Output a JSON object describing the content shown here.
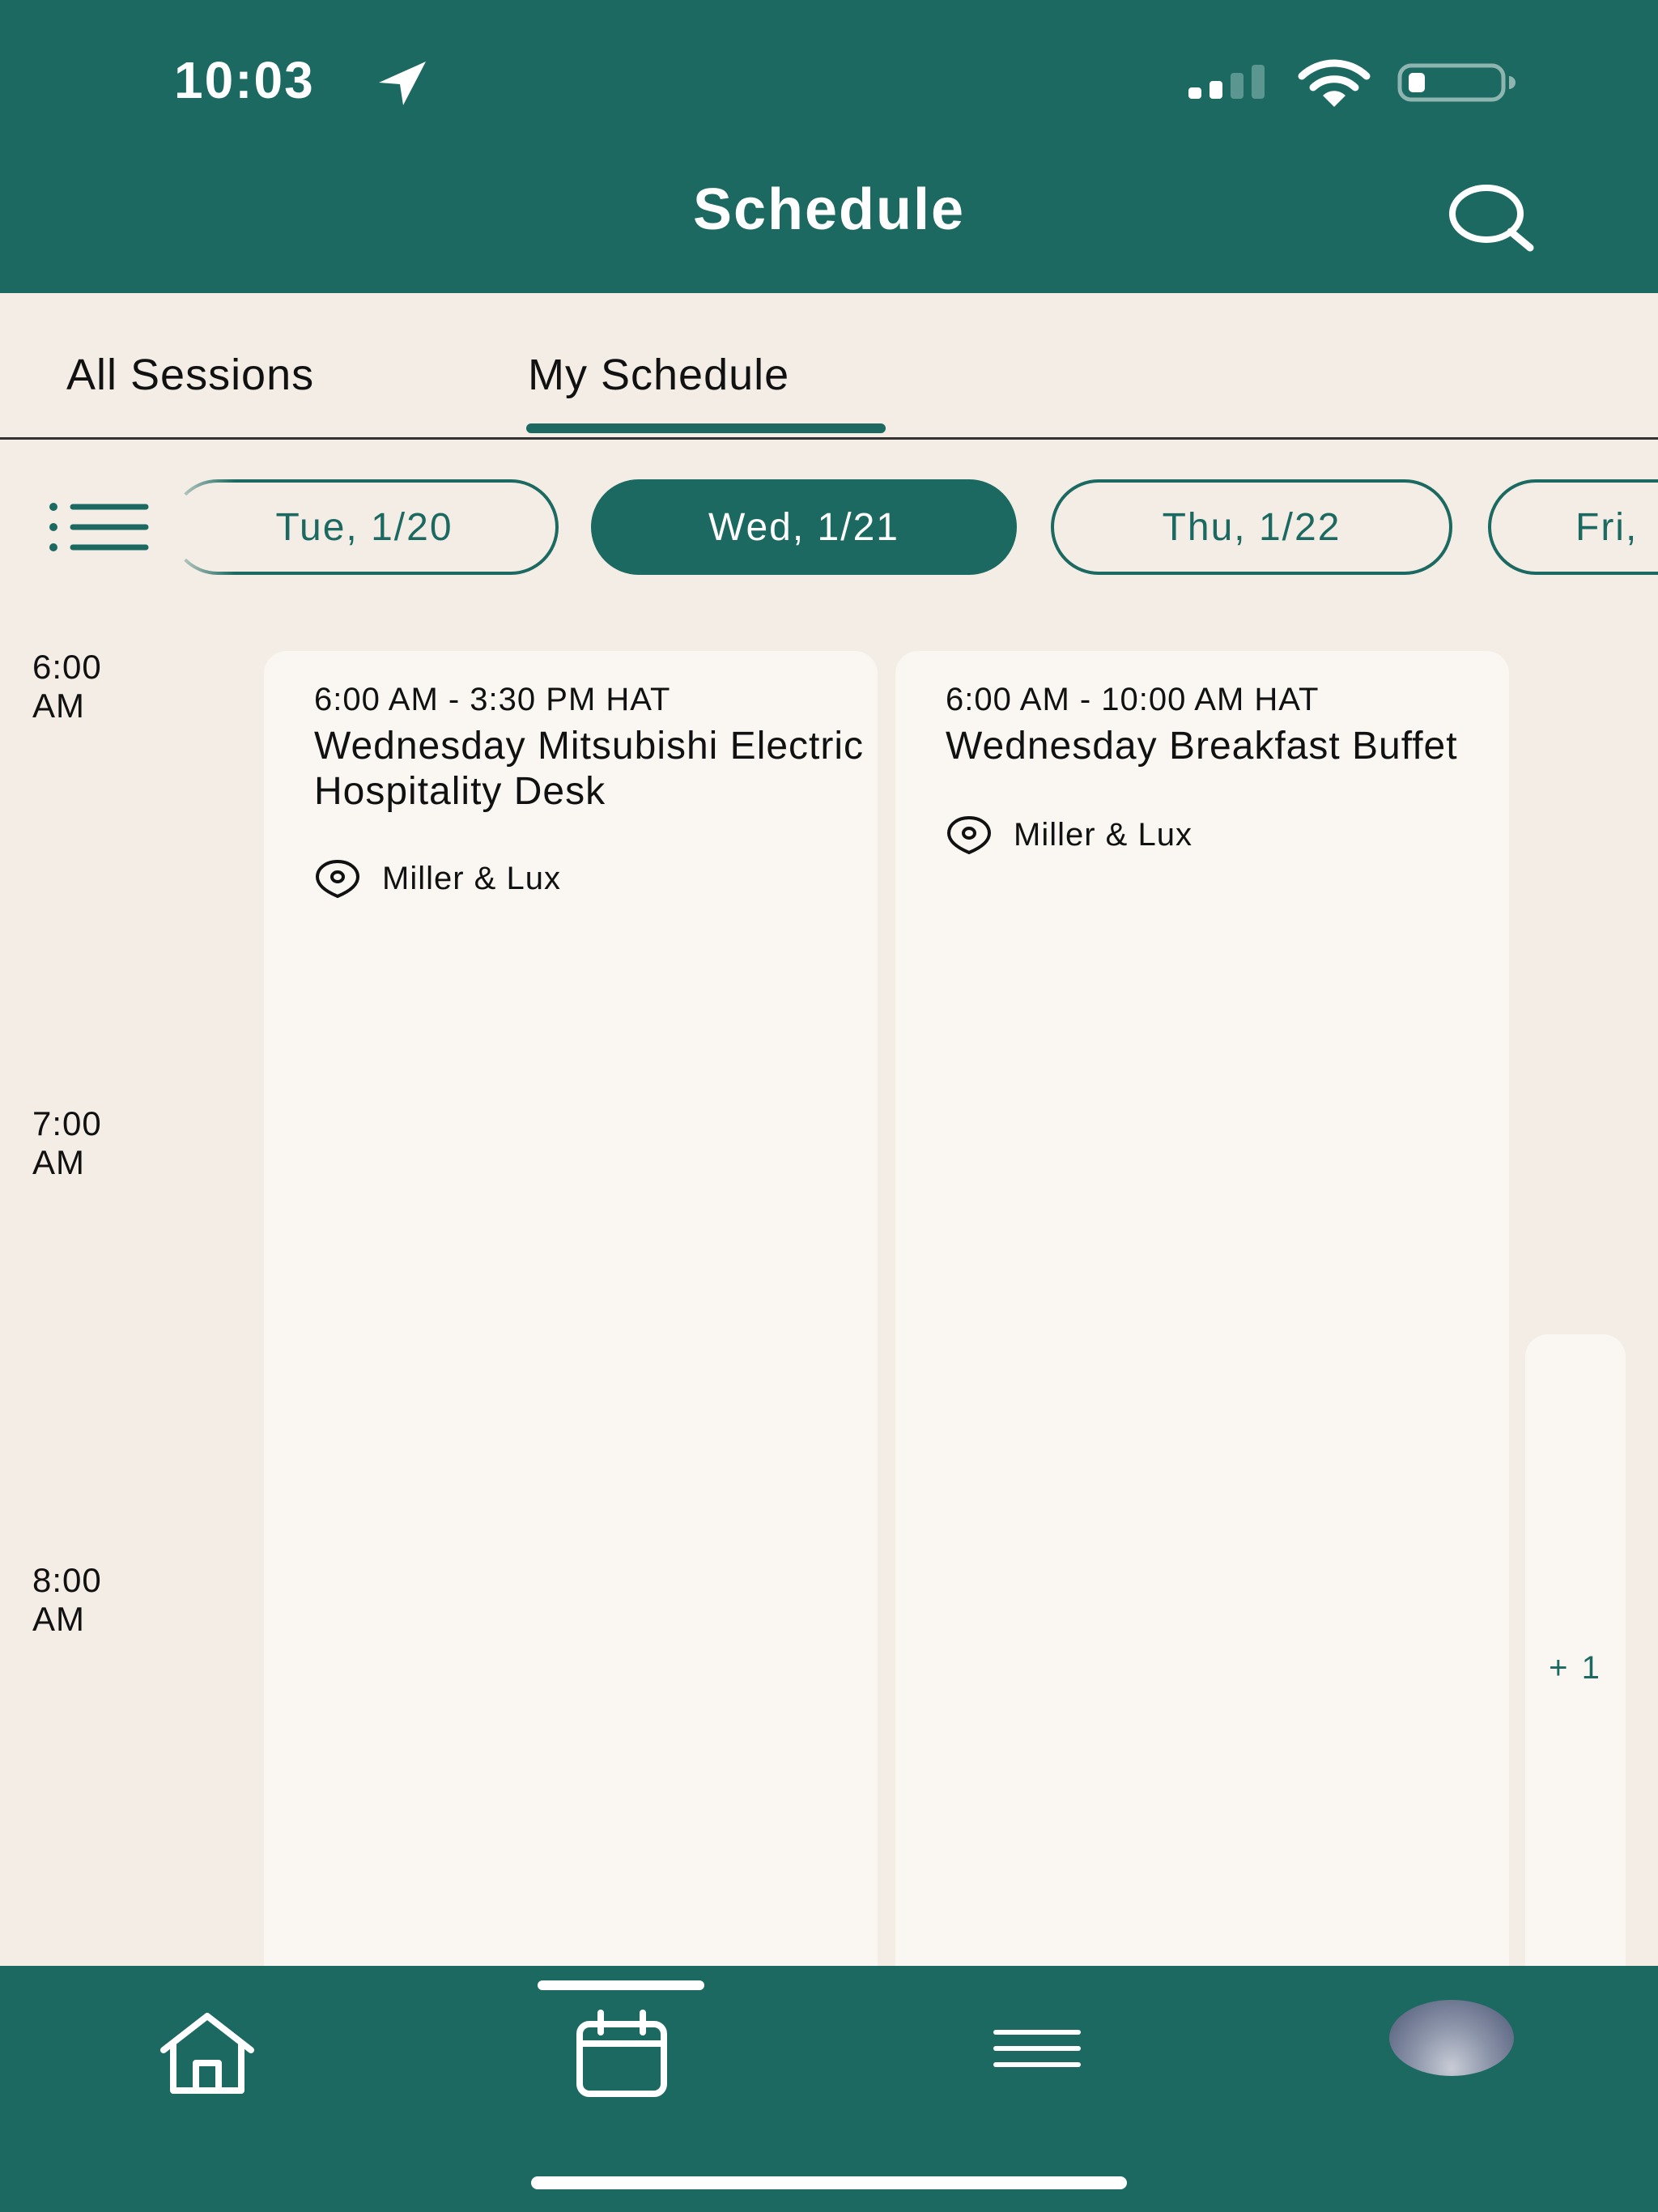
{
  "status_bar": {
    "time": "10:03"
  },
  "header": {
    "title": "Schedule"
  },
  "tabs": [
    {
      "label": "All Sessions"
    },
    {
      "label": "My Schedule",
      "selected": true
    }
  ],
  "days": [
    {
      "label": "Tue, 1/20"
    },
    {
      "label": "Wed, 1/21",
      "selected": true
    },
    {
      "label": "Thu, 1/22"
    },
    {
      "label": "Fri,"
    }
  ],
  "time_slots": [
    "6:00\nAM",
    "7:00\nAM",
    "8:00\nAM"
  ],
  "time_lines": [
    {
      "hour": "6:00",
      "period": "AM"
    },
    {
      "hour": "7:00",
      "period": "AM"
    },
    {
      "hour": "8:00",
      "period": "AM"
    }
  ],
  "sessions": [
    {
      "time": "6:00 AM - 3:30 PM HAT",
      "title": "Wednesday Mitsubishi Electric Hospitality Desk",
      "location": "Miller & Lux"
    },
    {
      "time": "6:00 AM - 10:00 AM HAT",
      "title": "Wednesday Breakfast Buffet",
      "location": "Miller & Lux"
    }
  ],
  "more_sessions_label": "+ 1",
  "colors": {
    "brand": "#1b6960",
    "background": "#f3ede6",
    "card": "#faf7f3"
  },
  "icons": {
    "location": "location-arrow-icon",
    "search": "search-icon",
    "filter": "list-icon",
    "pin": "map-pin-icon",
    "home": "home-icon",
    "calendar": "calendar-icon",
    "menu": "hamburger-menu-icon"
  }
}
